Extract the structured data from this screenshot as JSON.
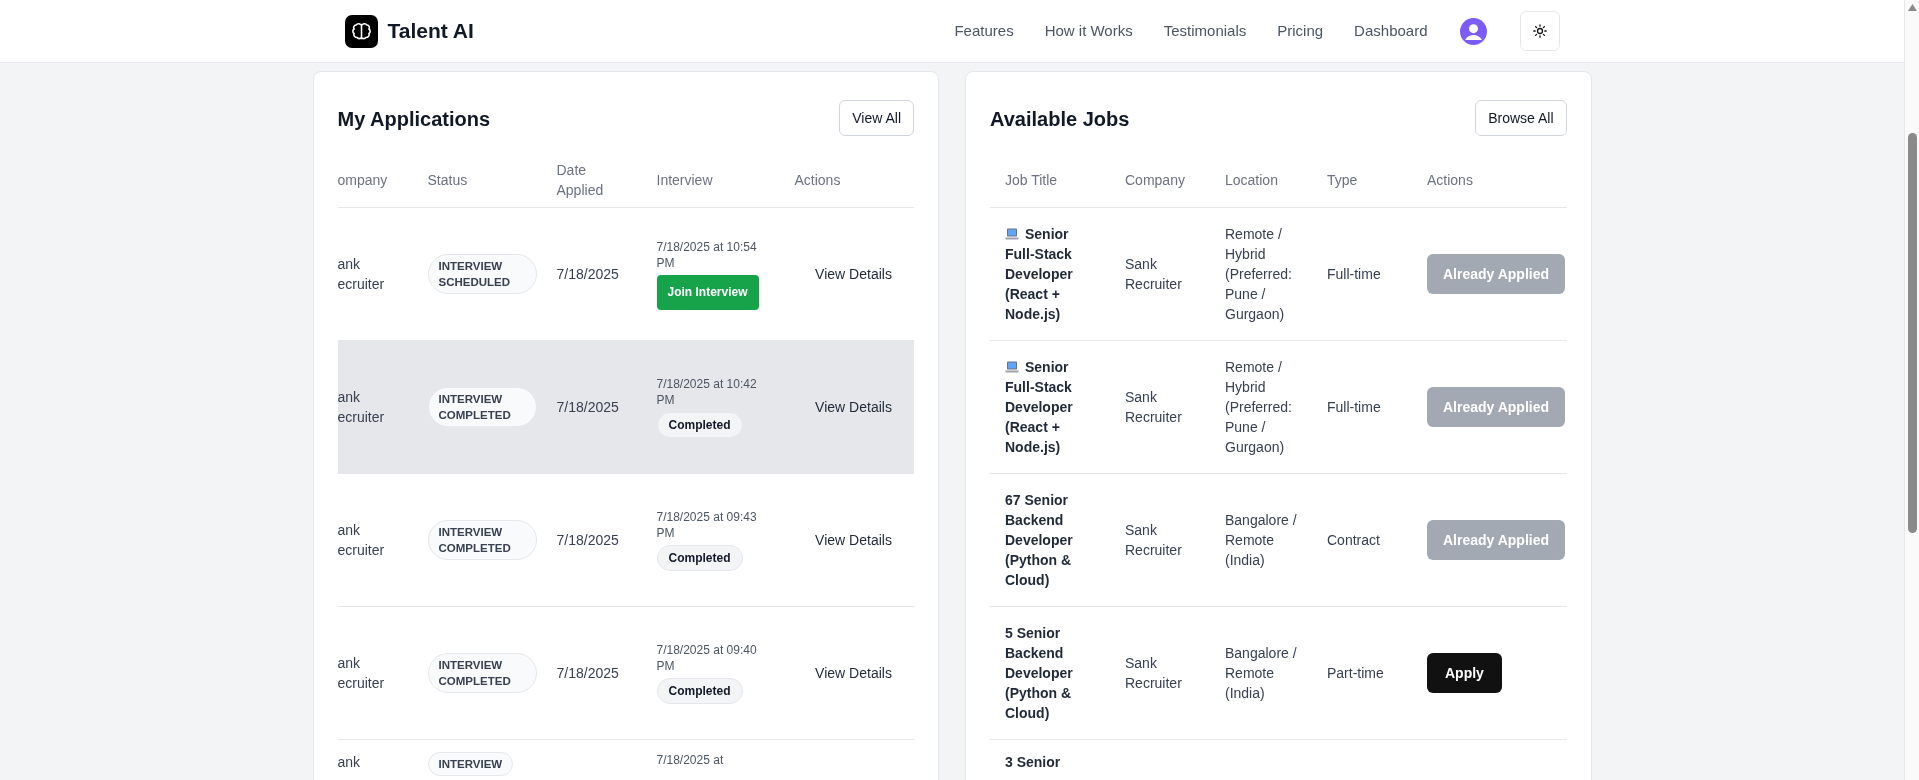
{
  "header": {
    "brand": "Talent AI",
    "nav": [
      {
        "label": "Features"
      },
      {
        "label": "How it Works"
      },
      {
        "label": "Testimonials"
      },
      {
        "label": "Pricing"
      },
      {
        "label": "Dashboard"
      }
    ]
  },
  "applications": {
    "title": "My Applications",
    "button": "View All",
    "columns": [
      "ompany",
      "Status",
      "Date Applied",
      "Interview",
      "Actions"
    ],
    "rows": [
      {
        "company": "ank ecruiter",
        "status": "INTERVIEW SCHEDULED",
        "date": "7/18/2025",
        "interview_time": "7/18/2025 at 10:54 PM",
        "interview_action": {
          "kind": "button",
          "label": "Join Interview"
        },
        "action": "View Details",
        "hovered": false
      },
      {
        "company": "ank ecruiter",
        "status": "INTERVIEW COMPLETED",
        "date": "7/18/2025",
        "interview_time": "7/18/2025 at 10:42 PM",
        "interview_action": {
          "kind": "badge",
          "label": "Completed"
        },
        "action": "View Details",
        "hovered": true
      },
      {
        "company": "ank ecruiter",
        "status": "INTERVIEW COMPLETED",
        "date": "7/18/2025",
        "interview_time": "7/18/2025 at 09:43 PM",
        "interview_action": {
          "kind": "badge",
          "label": "Completed"
        },
        "action": "View Details",
        "hovered": false
      },
      {
        "company": "ank ecruiter",
        "status": "INTERVIEW COMPLETED",
        "date": "7/18/2025",
        "interview_time": "7/18/2025 at 09:40 PM",
        "interview_action": {
          "kind": "badge",
          "label": "Completed"
        },
        "action": "View Details",
        "hovered": false
      },
      {
        "company": "ank",
        "status": "INTERVIEW",
        "interview_time": "7/18/2025 at",
        "hovered": false
      }
    ]
  },
  "jobs": {
    "title": "Available Jobs",
    "button": "Browse All",
    "columns": [
      "Job Title",
      "Company",
      "Location",
      "Type",
      "Actions"
    ],
    "rows": [
      {
        "has_icon": true,
        "title": "Senior Full-Stack Developer (React + Node.js)",
        "company": "Sank Recruiter",
        "location": "Remote / Hybrid (Preferred: Pune / Gurgaon)",
        "type": "Full-time",
        "action": {
          "label": "Already Applied",
          "disabled": true
        }
      },
      {
        "has_icon": true,
        "title": "Senior Full-Stack Developer (React + Node.js)",
        "company": "Sank Recruiter",
        "location": "Remote / Hybrid (Preferred: Pune / Gurgaon)",
        "type": "Full-time",
        "action": {
          "label": "Already Applied",
          "disabled": true
        }
      },
      {
        "has_icon": false,
        "title": "67 Senior Backend Developer (Python & Cloud)",
        "company": "Sank Recruiter",
        "location": "Bangalore / Remote (India)",
        "type": "Contract",
        "action": {
          "label": "Already Applied",
          "disabled": true
        }
      },
      {
        "has_icon": false,
        "title": "5 Senior Backend Developer (Python & Cloud)",
        "company": "Sank Recruiter",
        "location": "Bangalore / Remote (India)",
        "type": "Part-time",
        "action": {
          "label": "Apply",
          "disabled": false
        }
      },
      {
        "has_icon": false,
        "title": "3 Senior"
      }
    ]
  }
}
